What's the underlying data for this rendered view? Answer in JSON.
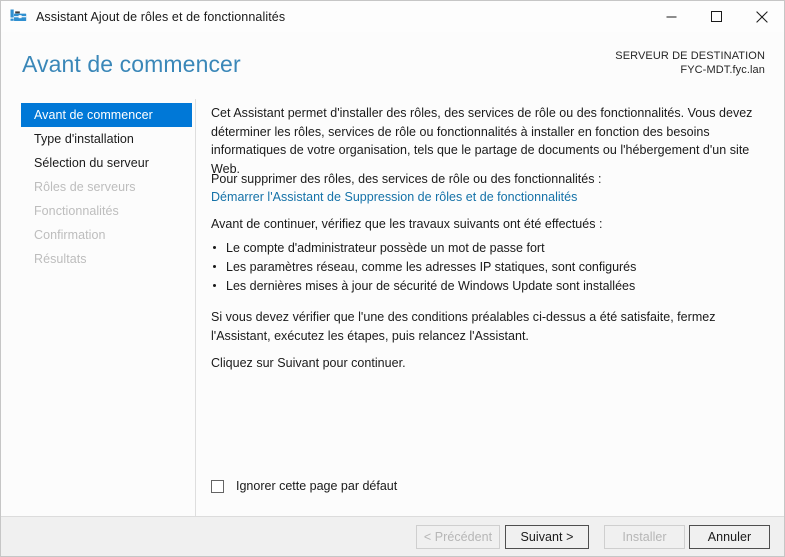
{
  "window": {
    "title": "Assistant Ajout de rôles et de fonctionnalités",
    "icon": "toolbox-icon",
    "controls": {
      "minimize": "minimize-icon",
      "maximize": "maximize-icon",
      "close": "close-icon"
    }
  },
  "header": {
    "page_title": "Avant de commencer",
    "destination_label": "SERVEUR DE DESTINATION",
    "destination_server": "FYC-MDT.fyc.lan"
  },
  "sidebar": {
    "items": [
      {
        "label": "Avant de commencer",
        "state": "selected"
      },
      {
        "label": "Type d'installation",
        "state": "enabled"
      },
      {
        "label": "Sélection du serveur",
        "state": "enabled"
      },
      {
        "label": "Rôles de serveurs",
        "state": "disabled"
      },
      {
        "label": "Fonctionnalités",
        "state": "disabled"
      },
      {
        "label": "Confirmation",
        "state": "disabled"
      },
      {
        "label": "Résultats",
        "state": "disabled"
      }
    ]
  },
  "content": {
    "intro_paragraph": "Cet Assistant permet d'installer des rôles, des services de rôle ou des fonctionnalités. Vous devez déterminer les rôles, services de rôle ou fonctionnalités à installer en fonction des besoins informatiques de votre organisation, tels que le partage de documents ou l'hébergement d'un site Web.",
    "remove_intro": "Pour supprimer des rôles, des services de rôle ou des fonctionnalités :",
    "remove_link": "Démarrer l'Assistant de Suppression de rôles et de fonctionnalités",
    "prereq_intro": "Avant de continuer, vérifiez que les travaux suivants ont été effectués :",
    "prereqs": [
      "Le compte d'administrateur possède un mot de passe fort",
      "Les paramètres réseau, comme les adresses IP statiques, sont configurés",
      "Les dernières mises à jour de sécurité de Windows Update sont installées"
    ],
    "verify_paragraph": "Si vous devez vérifier que l'une des conditions préalables ci-dessus a été satisfaite, fermez l'Assistant, exécutez les étapes, puis relancez l'Assistant.",
    "continue_paragraph": "Cliquez sur Suivant pour continuer.",
    "skip_checkbox_label": "Ignorer cette page par défaut",
    "skip_checkbox_checked": false
  },
  "footer": {
    "buttons": [
      {
        "label": "< Précédent",
        "state": "disabled"
      },
      {
        "label": "Suivant >",
        "state": "default"
      },
      {
        "label": "Installer",
        "state": "disabled"
      },
      {
        "label": "Annuler",
        "state": "default"
      }
    ]
  },
  "colors": {
    "accent_blue": "#0078d7",
    "title_blue": "#3a87b8",
    "link_blue": "#1572a8",
    "footer_bg": "#f0f0f0"
  }
}
